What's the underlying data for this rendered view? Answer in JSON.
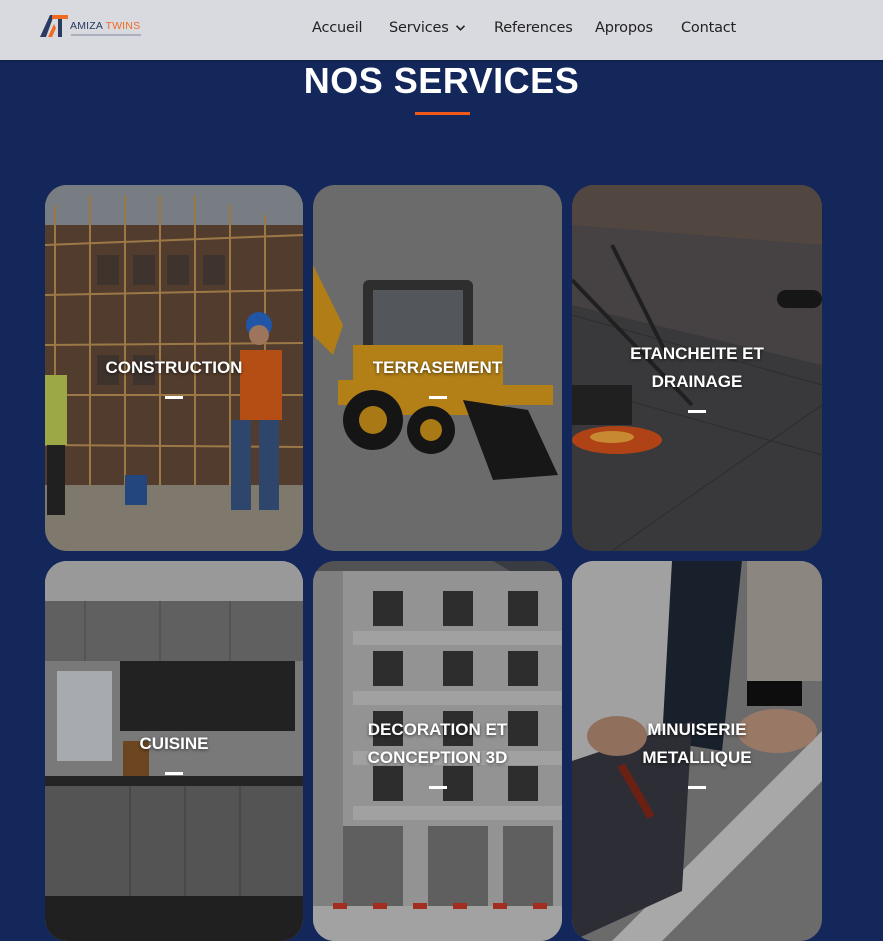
{
  "header": {
    "logo": {
      "word1": "AMIZA",
      "word2": "TWINS",
      "icon": "atw-logo-icon"
    },
    "nav": [
      {
        "label": "Accueil"
      },
      {
        "label": "Services",
        "icon": "chevron-down-icon"
      },
      {
        "label": "References"
      },
      {
        "label": "Apropos"
      },
      {
        "label": "Contact"
      }
    ]
  },
  "section": {
    "title": "NOS SERVICES",
    "accent_color": "#ef5a1a",
    "background_color": "#14275a"
  },
  "services": [
    {
      "label": "CONSTRUCTION",
      "image": "construction-workers-scaffolding"
    },
    {
      "label": "TERRASEMENT",
      "image": "yellow-backhoe-loader"
    },
    {
      "label": "ETANCHEITE ET\nDRAINAGE",
      "image": "roof-waterproofing-torch"
    },
    {
      "label": "CUISINE",
      "image": "modern-kitchen"
    },
    {
      "label": "DECORATION ET\nCONCEPTION 3D",
      "image": "building-3d-render"
    },
    {
      "label": "MINUISERIE\nMETALLIQUE",
      "image": "metal-worker-hands"
    }
  ]
}
